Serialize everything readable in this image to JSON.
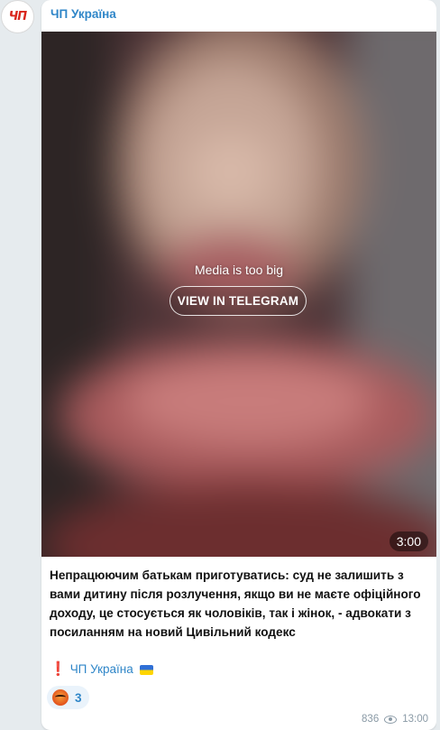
{
  "channel": {
    "name": "ЧП Україна",
    "avatar_text": "ЧП"
  },
  "media": {
    "message": "Media is too big",
    "button_label": "VIEW IN TELEGRAM",
    "duration": "3:00"
  },
  "post": {
    "text": "Непрацюючим батькам приготуватись: суд не залишить з вами дитину після розлучення, якщо ви не маєте офіційного доходу, це стосується як чоловіків, так і жінок, - адвокати з посиланням на новий Цивільний кодекс",
    "signature_mark": "❗",
    "signature_link": "ЧП Україна"
  },
  "reactions": [
    {
      "icon": "angry-face-icon",
      "count": "3"
    }
  ],
  "footer": {
    "views": "836",
    "time": "13:00"
  },
  "colors": {
    "background": "#e6ebee",
    "link": "#2f86c8",
    "avatar_accent": "#d9261c"
  }
}
